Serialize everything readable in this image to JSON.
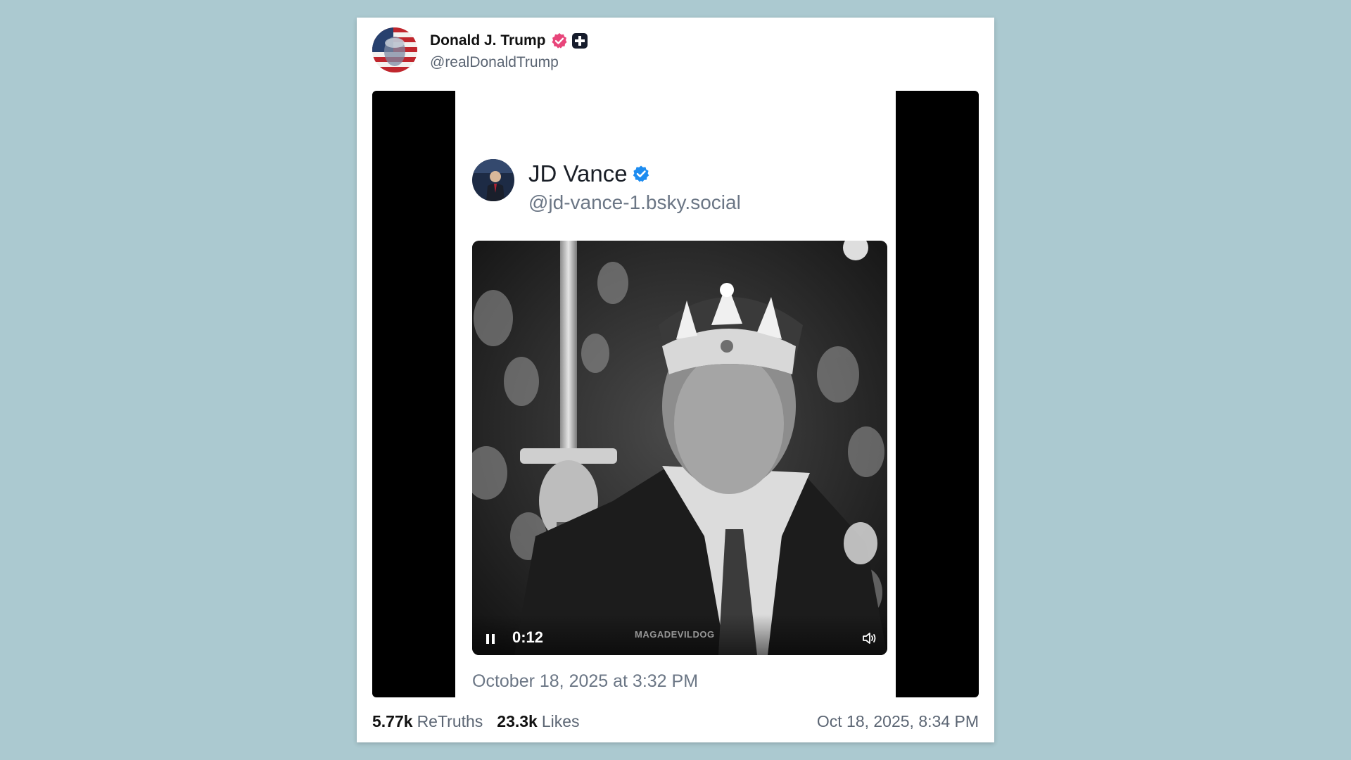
{
  "post": {
    "author_name": "Donald J. Trump",
    "author_handle": "@realDonaldTrump",
    "verified_badge_icon": "verified-badge-icon",
    "plus_badge_icon": "truth-plus-icon",
    "badge_color": "#e8457a"
  },
  "embedded_post": {
    "author_name": "JD Vance",
    "author_handle": "@jd-vance-1.bsky.social",
    "verified_icon": "verified-check-icon",
    "verified_color": "#1d8cf0",
    "video": {
      "time": "0:12",
      "watermark": "MAGADEVILDOG",
      "pause_icon": "pause-icon",
      "volume_icon": "volume-icon"
    },
    "date": "October 18, 2025 at 3:32 PM"
  },
  "footer": {
    "retruths_count": "5.77k",
    "retruths_label": "ReTruths",
    "likes_count": "23.3k",
    "likes_label": "Likes",
    "timestamp": "Oct 18, 2025, 8:34 PM"
  }
}
